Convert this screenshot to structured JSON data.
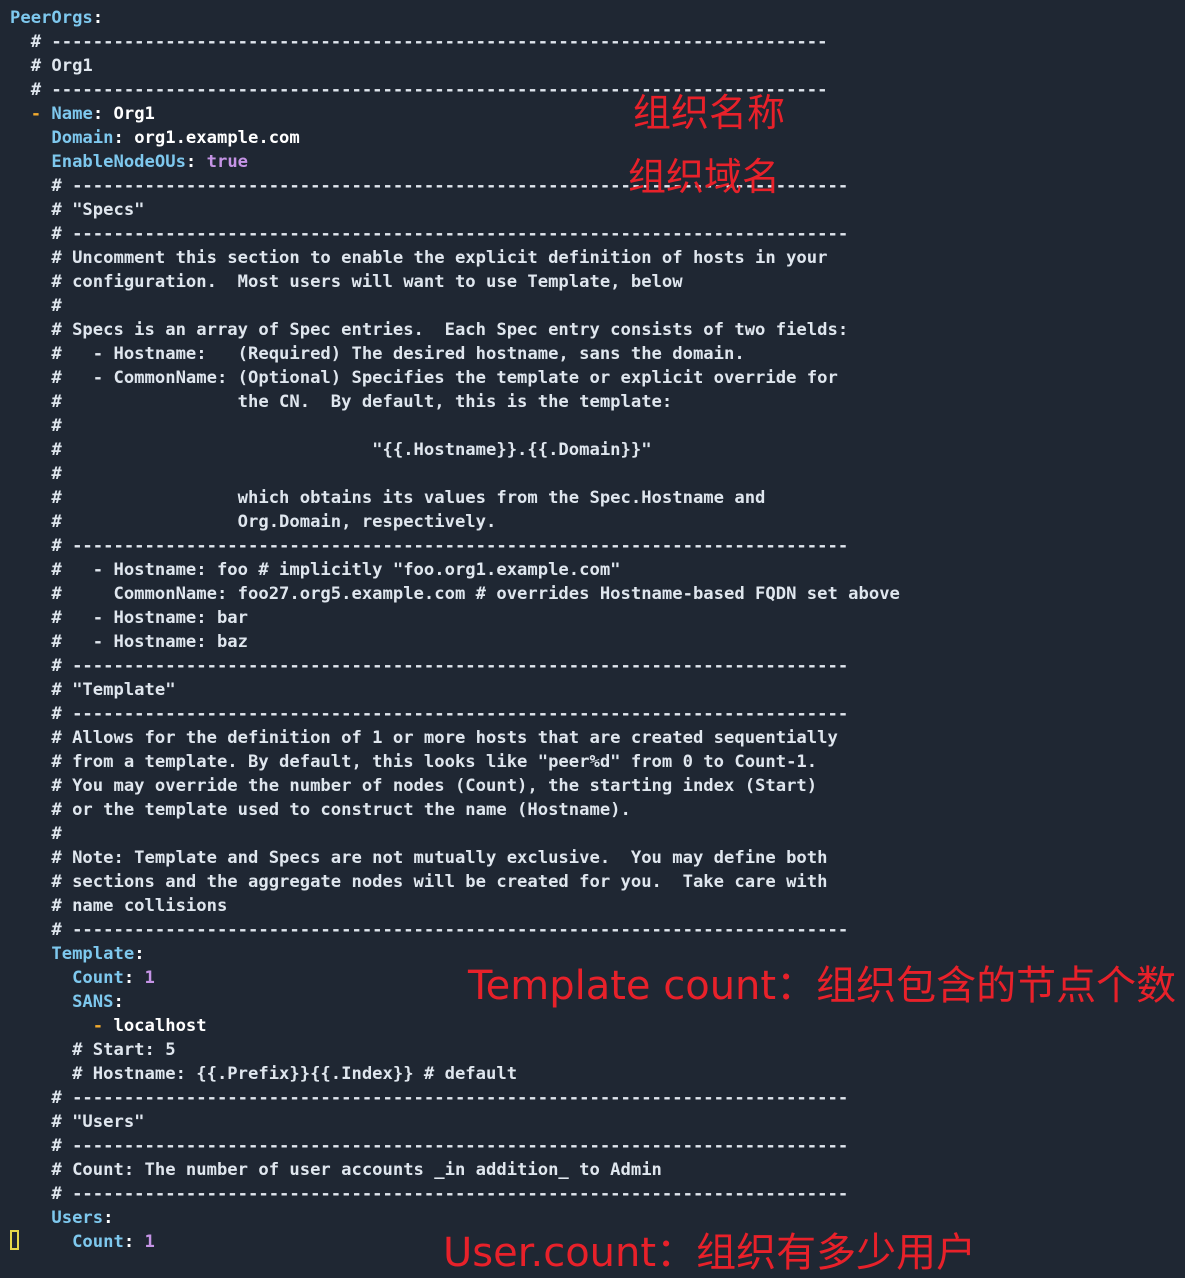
{
  "colors": {
    "background": "#1f2733",
    "comment": "#dfe6ee",
    "key": "#7ec8ee",
    "value": "#ffffff",
    "number": "#c594e6",
    "dash": "#f0a92e",
    "annotation": "#e8212a",
    "cursor": "#e6d84a"
  },
  "lines": [
    [
      {
        "t": "key",
        "v": "PeerOrgs"
      },
      {
        "t": "punct",
        "v": ":"
      }
    ],
    [
      {
        "t": "comment",
        "v": "  # ---------------------------------------------------------------------------"
      }
    ],
    [
      {
        "t": "comment",
        "v": "  # Org1"
      }
    ],
    [
      {
        "t": "comment",
        "v": "  # ---------------------------------------------------------------------------"
      }
    ],
    [
      {
        "t": "dash",
        "v": "  - "
      },
      {
        "t": "key",
        "v": "Name"
      },
      {
        "t": "punct",
        "v": ": "
      },
      {
        "t": "value",
        "v": "Org1"
      }
    ],
    [
      {
        "t": "key",
        "v": "    Domain"
      },
      {
        "t": "punct",
        "v": ": "
      },
      {
        "t": "value",
        "v": "org1.example.com"
      }
    ],
    [
      {
        "t": "key",
        "v": "    EnableNodeOUs"
      },
      {
        "t": "punct",
        "v": ": "
      },
      {
        "t": "bool",
        "v": "true"
      }
    ],
    [
      {
        "t": "comment",
        "v": "    # ---------------------------------------------------------------------------"
      }
    ],
    [
      {
        "t": "comment",
        "v": "    # \"Specs\""
      }
    ],
    [
      {
        "t": "comment",
        "v": "    # ---------------------------------------------------------------------------"
      }
    ],
    [
      {
        "t": "comment",
        "v": "    # Uncomment this section to enable the explicit definition of hosts in your"
      }
    ],
    [
      {
        "t": "comment",
        "v": "    # configuration.  Most users will want to use Template, below"
      }
    ],
    [
      {
        "t": "comment",
        "v": "    #"
      }
    ],
    [
      {
        "t": "comment",
        "v": "    # Specs is an array of Spec entries.  Each Spec entry consists of two fields:"
      }
    ],
    [
      {
        "t": "comment",
        "v": "    #   - Hostname:   (Required) The desired hostname, sans the domain."
      }
    ],
    [
      {
        "t": "comment",
        "v": "    #   - CommonName: (Optional) Specifies the template or explicit override for"
      }
    ],
    [
      {
        "t": "comment",
        "v": "    #                 the CN.  By default, this is the template:"
      }
    ],
    [
      {
        "t": "comment",
        "v": "    #"
      }
    ],
    [
      {
        "t": "comment",
        "v": "    #                              \"{{.Hostname}}.{{.Domain}}\""
      }
    ],
    [
      {
        "t": "comment",
        "v": "    #"
      }
    ],
    [
      {
        "t": "comment",
        "v": "    #                 which obtains its values from the Spec.Hostname and"
      }
    ],
    [
      {
        "t": "comment",
        "v": "    #                 Org.Domain, respectively."
      }
    ],
    [
      {
        "t": "comment",
        "v": "    # ---------------------------------------------------------------------------"
      }
    ],
    [
      {
        "t": "comment",
        "v": "    #   - Hostname: foo # implicitly \"foo.org1.example.com\""
      }
    ],
    [
      {
        "t": "comment",
        "v": "    #     CommonName: foo27.org5.example.com # overrides Hostname-based FQDN set above"
      }
    ],
    [
      {
        "t": "comment",
        "v": "    #   - Hostname: bar"
      }
    ],
    [
      {
        "t": "comment",
        "v": "    #   - Hostname: baz"
      }
    ],
    [
      {
        "t": "comment",
        "v": "    # ---------------------------------------------------------------------------"
      }
    ],
    [
      {
        "t": "comment",
        "v": "    # \"Template\""
      }
    ],
    [
      {
        "t": "comment",
        "v": "    # ---------------------------------------------------------------------------"
      }
    ],
    [
      {
        "t": "comment",
        "v": "    # Allows for the definition of 1 or more hosts that are created sequentially"
      }
    ],
    [
      {
        "t": "comment",
        "v": "    # from a template. By default, this looks like \"peer%d\" from 0 to Count-1."
      }
    ],
    [
      {
        "t": "comment",
        "v": "    # You may override the number of nodes (Count), the starting index (Start)"
      }
    ],
    [
      {
        "t": "comment",
        "v": "    # or the template used to construct the name (Hostname)."
      }
    ],
    [
      {
        "t": "comment",
        "v": "    #"
      }
    ],
    [
      {
        "t": "comment",
        "v": "    # Note: Template and Specs are not mutually exclusive.  You may define both"
      }
    ],
    [
      {
        "t": "comment",
        "v": "    # sections and the aggregate nodes will be created for you.  Take care with"
      }
    ],
    [
      {
        "t": "comment",
        "v": "    # name collisions"
      }
    ],
    [
      {
        "t": "comment",
        "v": "    # ---------------------------------------------------------------------------"
      }
    ],
    [
      {
        "t": "key",
        "v": "    Template"
      },
      {
        "t": "punct",
        "v": ":"
      }
    ],
    [
      {
        "t": "key",
        "v": "      Count"
      },
      {
        "t": "punct",
        "v": ": "
      },
      {
        "t": "num",
        "v": "1"
      }
    ],
    [
      {
        "t": "key",
        "v": "      SANS"
      },
      {
        "t": "punct",
        "v": ":"
      }
    ],
    [
      {
        "t": "dash",
        "v": "        - "
      },
      {
        "t": "value",
        "v": "localhost"
      }
    ],
    [
      {
        "t": "comment",
        "v": "      # Start: 5"
      }
    ],
    [
      {
        "t": "comment",
        "v": "      # Hostname: {{.Prefix}}{{.Index}} # default"
      }
    ],
    [
      {
        "t": "comment",
        "v": "    # ---------------------------------------------------------------------------"
      }
    ],
    [
      {
        "t": "comment",
        "v": "    # \"Users\""
      }
    ],
    [
      {
        "t": "comment",
        "v": "    # ---------------------------------------------------------------------------"
      }
    ],
    [
      {
        "t": "comment",
        "v": "    # Count: The number of user accounts _in addition_ to Admin"
      }
    ],
    [
      {
        "t": "comment",
        "v": "    # ---------------------------------------------------------------------------"
      }
    ],
    [
      {
        "t": "key",
        "v": "    Users"
      },
      {
        "t": "punct",
        "v": ":"
      }
    ],
    [
      {
        "t": "key",
        "v": "      Count"
      },
      {
        "t": "punct",
        "v": ": "
      },
      {
        "t": "num",
        "v": "1"
      }
    ]
  ],
  "annotations": {
    "org_name": "组织名称",
    "org_domain": "组织域名",
    "template_count": "Template count：组织包含的节点个数",
    "user_count": "User.count：组织有多少用户"
  }
}
